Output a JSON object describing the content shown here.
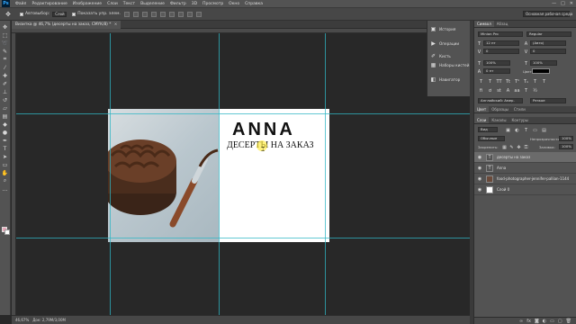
{
  "menu": {
    "logo": "Ps",
    "items": [
      "Файл",
      "Редактирование",
      "Изображение",
      "Слои",
      "Текст",
      "Выделение",
      "Фильтр",
      "3D",
      "Просмотр",
      "Окно",
      "Справка"
    ],
    "window_controls": [
      "—",
      "□",
      "✕"
    ]
  },
  "options": {
    "auto_select_label": "Автовыбор:",
    "auto_select_value": "Слой",
    "show_controls_label": "Показать упр. элем.",
    "workspace": "Основная рабочая среда"
  },
  "document": {
    "tab_title": "Визитка @ 46,7% (десерты на заказ, CMYK/8) *",
    "close": "×",
    "brand": "ANNA",
    "subtitle": "ДЕСЕРТЫ НА ЗАКАЗ"
  },
  "status": {
    "zoom": "46,67%",
    "doc_size": "Док: 2,79М/3,00М"
  },
  "icon_panel": {
    "items": [
      {
        "label": "История",
        "icon": "history-icon"
      },
      {
        "label": "Операции",
        "icon": "actions-icon"
      },
      {
        "label": "Кисть",
        "icon": "brush-icon"
      },
      {
        "label": "Наборы кистей",
        "icon": "brush-presets-icon"
      },
      {
        "label": "Навигатор",
        "icon": "navigator-icon"
      }
    ]
  },
  "character_panel": {
    "tabs": [
      "Символ",
      "Абзац"
    ],
    "font_family": "Minion Pro",
    "font_style": "Regular",
    "font_size": "12 пт",
    "leading": "(Авто)",
    "tracking": "0",
    "kerning": "0",
    "vscale": "100%",
    "hscale": "100%",
    "baseline": "0 пт",
    "color_label": "Цвет:",
    "language": "Английский: Амер.",
    "antialias": "Резкое"
  },
  "color_panel": {
    "tabs": [
      "Цвет",
      "Образцы",
      "Стили"
    ]
  },
  "layers_panel": {
    "tabs": [
      "Слои",
      "Каналы",
      "Контуры"
    ],
    "kind_filter": "Вид",
    "blend_mode": "Обычные",
    "opacity_label": "Непрозрачность:",
    "opacity_value": "100%",
    "lock_label": "Закрепить:",
    "fill_label": "Заливка:",
    "fill_value": "100%",
    "layers": [
      {
        "name": "десерты на заказ",
        "type": "T",
        "selected": true
      },
      {
        "name": "Anna",
        "type": "T",
        "selected": false
      },
      {
        "name": "food-photographer-jennifer-pallian-114424-unsp...",
        "type": "img",
        "selected": false
      },
      {
        "name": "Слой 0",
        "type": "fill",
        "selected": false
      }
    ]
  },
  "colors": {
    "guide": "#2fb6c4",
    "foreground": "#e8a6b8",
    "background": "#ffffff",
    "panel": "#535353"
  }
}
